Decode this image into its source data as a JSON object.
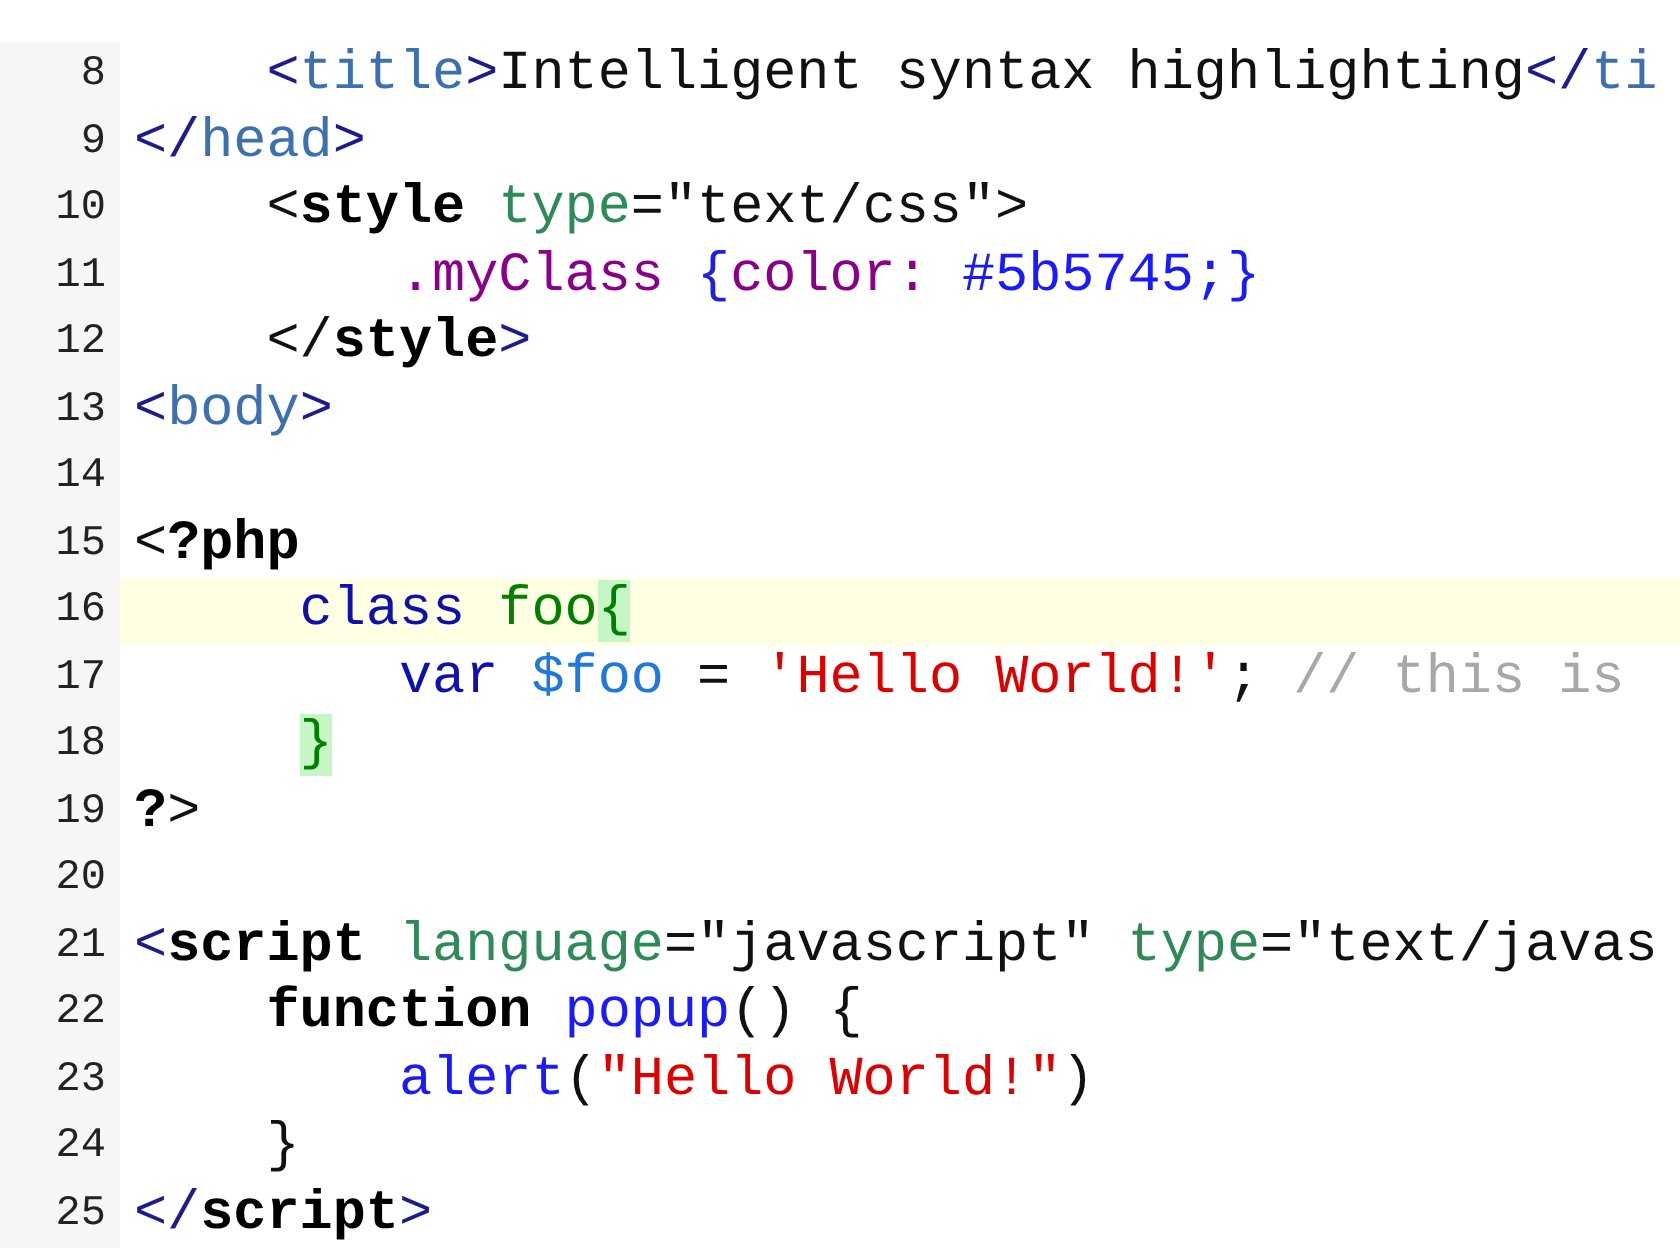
{
  "editor": {
    "lines": [
      {
        "number": "8",
        "current": false,
        "kind": "block",
        "tokens": [
          {
            "kind": "bracket",
            "text": "<"
          },
          {
            "kind": "tag",
            "text": "title"
          },
          {
            "kind": "bracket",
            "text": ">"
          },
          {
            "kind": "plain",
            "text": "Intelligent syntax highlighting"
          },
          {
            "kind": "bracket",
            "text": "</"
          },
          {
            "kind": "tag",
            "text": "ti"
          }
        ]
      },
      {
        "number": "9",
        "current": false,
        "kind": "top",
        "tokens": [
          {
            "kind": "bracket",
            "text": "</"
          },
          {
            "kind": "tag",
            "text": "head"
          },
          {
            "kind": "bracket",
            "text": ">"
          }
        ]
      },
      {
        "number": "10",
        "current": false,
        "kind": "block",
        "tokens": [
          {
            "kind": "plain",
            "text": "<"
          },
          {
            "kind": "bold",
            "text": "style "
          },
          {
            "kind": "attr",
            "text": "type"
          },
          {
            "kind": "plain",
            "text": "=\"text/css\">"
          }
        ]
      },
      {
        "number": "11",
        "current": false,
        "kind": "inner",
        "tokens": [
          {
            "kind": "css",
            "text": ".myClass "
          },
          {
            "kind": "brace",
            "text": "{"
          },
          {
            "kind": "css",
            "text": "color: "
          },
          {
            "kind": "value",
            "text": "#5b5745;}"
          }
        ]
      },
      {
        "number": "12",
        "current": false,
        "kind": "block",
        "tokens": [
          {
            "kind": "plain",
            "text": "</"
          },
          {
            "kind": "bold",
            "text": "style"
          },
          {
            "kind": "bracket",
            "text": ">"
          }
        ]
      },
      {
        "number": "13",
        "current": false,
        "kind": "top",
        "tokens": [
          {
            "kind": "bracket",
            "text": "<"
          },
          {
            "kind": "tag",
            "text": "body"
          },
          {
            "kind": "bracket",
            "text": ">"
          }
        ]
      },
      {
        "number": "14",
        "current": false,
        "kind": "top"
      },
      {
        "number": "15",
        "current": false,
        "kind": "top",
        "tokens": [
          {
            "kind": "plain",
            "text": "<"
          },
          {
            "kind": "bold",
            "text": "?php"
          }
        ]
      },
      {
        "number": "16",
        "current": true,
        "kind": "member",
        "tokens": [
          {
            "kind": "keyword",
            "text": "class "
          },
          {
            "kind": "classname",
            "text": "foo"
          },
          {
            "kind": "match",
            "text": "{"
          }
        ]
      },
      {
        "number": "17",
        "current": false,
        "kind": "inner",
        "tokens": [
          {
            "kind": "keyword",
            "text": "var "
          },
          {
            "kind": "variable",
            "text": "$foo"
          },
          {
            "kind": "plain",
            "text": " = "
          },
          {
            "kind": "string",
            "text": "'Hello World!'"
          },
          {
            "kind": "plain",
            "text": "; "
          },
          {
            "kind": "comment",
            "text": "// this is"
          }
        ]
      },
      {
        "number": "18",
        "current": false,
        "kind": "member",
        "tokens": [
          {
            "kind": "match",
            "text": "}"
          }
        ]
      },
      {
        "number": "19",
        "current": false,
        "kind": "top",
        "tokens": [
          {
            "kind": "bold",
            "text": "?"
          },
          {
            "kind": "plain",
            "text": ">"
          }
        ]
      },
      {
        "number": "20",
        "current": false,
        "kind": "top"
      },
      {
        "number": "21",
        "current": false,
        "kind": "top",
        "tokens": [
          {
            "kind": "bracket",
            "text": "<"
          },
          {
            "kind": "bold",
            "text": "script "
          },
          {
            "kind": "attr",
            "text": "language"
          },
          {
            "kind": "plain",
            "text": "=\"javascript\" "
          },
          {
            "kind": "attr",
            "text": "type"
          },
          {
            "kind": "plain",
            "text": "=\"text/javas"
          }
        ]
      },
      {
        "number": "22",
        "current": false,
        "kind": "block",
        "tokens": [
          {
            "kind": "bold",
            "text": "function "
          },
          {
            "kind": "function",
            "text": "popup"
          },
          {
            "kind": "plain",
            "text": "() {"
          }
        ]
      },
      {
        "number": "23",
        "current": false,
        "kind": "inner",
        "tokens": [
          {
            "kind": "function",
            "text": "alert"
          },
          {
            "kind": "plain",
            "text": "("
          },
          {
            "kind": "string",
            "text": "\"Hello World!\""
          },
          {
            "kind": "plain",
            "text": ")"
          }
        ]
      },
      {
        "number": "24",
        "current": false,
        "kind": "block",
        "tokens": [
          {
            "kind": "plain",
            "text": "}"
          }
        ]
      },
      {
        "number": "25",
        "current": false,
        "kind": "top",
        "tokens": [
          {
            "kind": "bracket",
            "text": "</"
          },
          {
            "kind": "bold",
            "text": "script"
          },
          {
            "kind": "bracket",
            "text": ">"
          }
        ]
      }
    ]
  }
}
